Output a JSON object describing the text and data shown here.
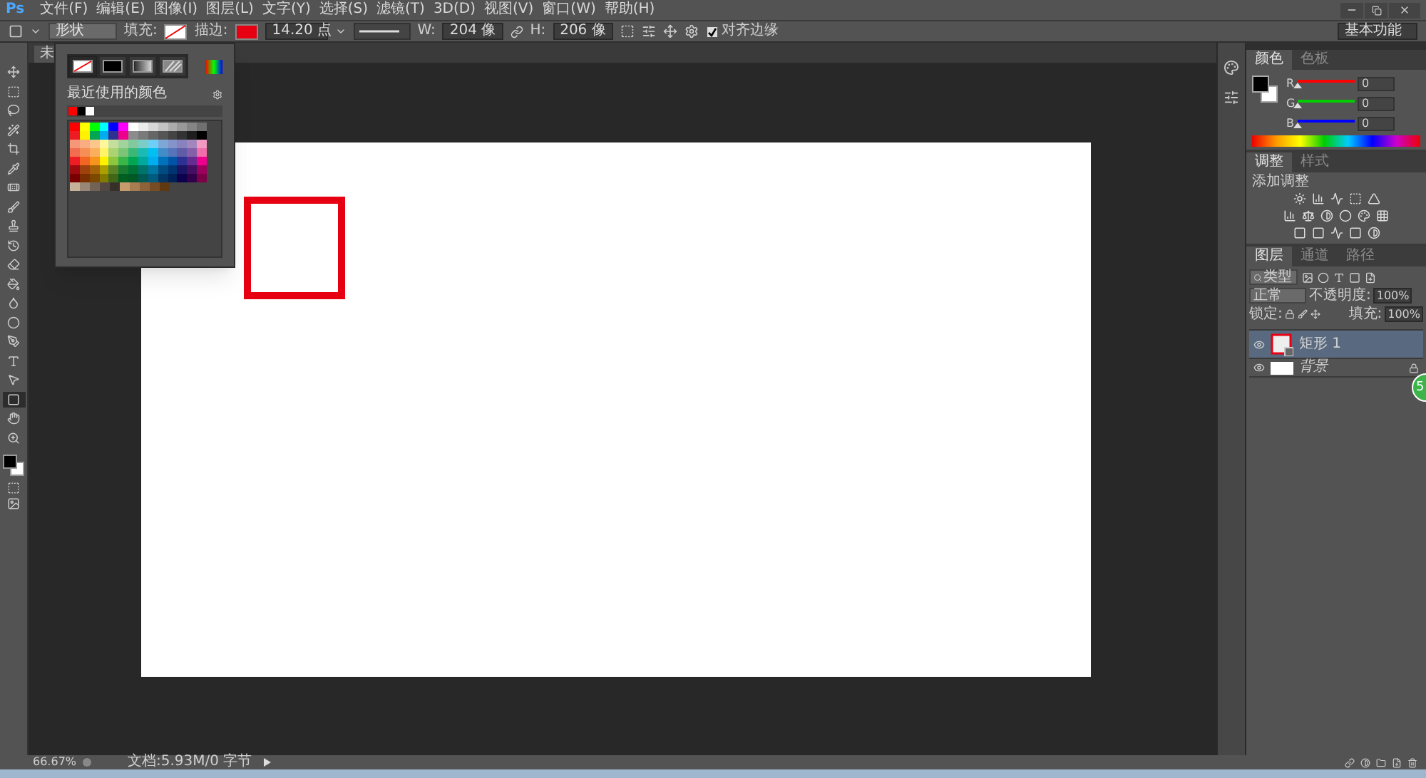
{
  "menu_bar": {
    "logo": "Ps",
    "items": [
      "文件(F)",
      "编辑(E)",
      "图像(I)",
      "图层(L)",
      "文字(Y)",
      "选择(S)",
      "滤镜(T)",
      "3D(D)",
      "视图(V)",
      "窗口(W)",
      "帮助(H)"
    ]
  },
  "options_bar": {
    "shape_mode": "形状",
    "fill_label": "填充:",
    "stroke_label": "描边:",
    "stroke_swatch": {
      "color": "#e60012"
    },
    "stroke_width": "14.20 点",
    "w_label": "W:",
    "w_value": "204 像",
    "h_label": "H:",
    "h_value": "206 像",
    "align_edges": {
      "label": "对齐边缘",
      "checked": true
    },
    "workspace": "基本功能"
  },
  "toolbar": {
    "tools": [
      {
        "kind": "move",
        "selected": false
      },
      {
        "kind": "marquee",
        "selected": false
      },
      {
        "kind": "lasso",
        "selected": false
      },
      {
        "kind": "wand",
        "selected": false
      },
      {
        "kind": "crop",
        "selected": false
      },
      {
        "kind": "pipette",
        "selected": false
      },
      {
        "kind": "bandage",
        "selected": false
      },
      {
        "kind": "brush",
        "selected": false
      },
      {
        "kind": "stamp",
        "selected": false
      },
      {
        "kind": "history",
        "selected": false
      },
      {
        "kind": "eraser",
        "selected": false
      },
      {
        "kind": "bucket",
        "selected": false
      },
      {
        "kind": "droplet",
        "selected": false
      },
      {
        "kind": "dodge",
        "selected": false
      },
      {
        "kind": "pen",
        "selected": false
      },
      {
        "kind": "type",
        "selected": false
      },
      {
        "kind": "pointer",
        "selected": false
      },
      {
        "kind": "rectangle",
        "selected": true
      },
      {
        "kind": "hand",
        "selected": false
      },
      {
        "kind": "zoom",
        "selected": false
      }
    ]
  },
  "document_tab": "未",
  "swatch_popup": {
    "tabs": [
      {
        "kind": "none",
        "selected": true
      },
      {
        "kind": "solid",
        "selected": false
      },
      {
        "kind": "gradient",
        "selected": false
      },
      {
        "kind": "pattern",
        "selected": false
      }
    ],
    "recent_label": "最近使用的颜色",
    "recent_colors": [
      {
        "color": "#ff0000"
      },
      {
        "color": "#000000"
      },
      {
        "color": "#ffffff"
      }
    ],
    "swatch_rows": [
      {
        "swatches": [
          {
            "color": "#ff0000"
          },
          {
            "color": "#ffff00"
          },
          {
            "color": "#00ff00"
          },
          {
            "color": "#00ffff"
          },
          {
            "color": "#0000ff"
          },
          {
            "color": "#ff00ff"
          },
          {
            "color": "#ffffff"
          },
          {
            "color": "#ebebeb"
          },
          {
            "color": "#d6d6d6"
          },
          {
            "color": "#c2c2c2"
          },
          {
            "color": "#adadad"
          },
          {
            "color": "#999999"
          },
          {
            "color": "#858585"
          },
          {
            "color": "#707070"
          }
        ]
      },
      {
        "swatches": [
          {
            "color": "#ed1c24"
          },
          {
            "color": "#fff200"
          },
          {
            "color": "#00a651"
          },
          {
            "color": "#00aeef"
          },
          {
            "color": "#2e3192"
          },
          {
            "color": "#ec008c"
          },
          {
            "color": "#8c8c8c"
          },
          {
            "color": "#7a7a7a"
          },
          {
            "color": "#666666"
          },
          {
            "color": "#555555"
          },
          {
            "color": "#444444"
          },
          {
            "color": "#333333"
          },
          {
            "color": "#1e1e1e"
          },
          {
            "color": "#000000"
          }
        ]
      },
      {
        "swatches": [
          {
            "color": "#f7977a"
          },
          {
            "color": "#f9ad81"
          },
          {
            "color": "#fdc68a"
          },
          {
            "color": "#fff79a"
          },
          {
            "color": "#c4df9b"
          },
          {
            "color": "#a3d39c"
          },
          {
            "color": "#82ca9d"
          },
          {
            "color": "#7bcdc8"
          },
          {
            "color": "#6ecff6"
          },
          {
            "color": "#7ea7d8"
          },
          {
            "color": "#8493ca"
          },
          {
            "color": "#8882be"
          },
          {
            "color": "#a187be"
          },
          {
            "color": "#f49ac2"
          }
        ]
      },
      {
        "swatches": [
          {
            "color": "#f26c4f"
          },
          {
            "color": "#f68e55"
          },
          {
            "color": "#fbaf5c"
          },
          {
            "color": "#fff467"
          },
          {
            "color": "#acd372"
          },
          {
            "color": "#7cc576"
          },
          {
            "color": "#3bb878"
          },
          {
            "color": "#1abbb4"
          },
          {
            "color": "#00bff3"
          },
          {
            "color": "#438cca"
          },
          {
            "color": "#5574b9"
          },
          {
            "color": "#605ca8"
          },
          {
            "color": "#855fa8"
          },
          {
            "color": "#f06eaa"
          }
        ]
      },
      {
        "swatches": [
          {
            "color": "#ed1c25"
          },
          {
            "color": "#f26522"
          },
          {
            "color": "#f7941d"
          },
          {
            "color": "#fff201"
          },
          {
            "color": "#8dc73f"
          },
          {
            "color": "#39b54a"
          },
          {
            "color": "#00a652"
          },
          {
            "color": "#00a99d"
          },
          {
            "color": "#00aef0"
          },
          {
            "color": "#0072bc"
          },
          {
            "color": "#0054a6"
          },
          {
            "color": "#2e3193"
          },
          {
            "color": "#662d91"
          },
          {
            "color": "#ec008d"
          }
        ]
      },
      {
        "swatches": [
          {
            "color": "#9e0b0f"
          },
          {
            "color": "#a0410d"
          },
          {
            "color": "#a36209"
          },
          {
            "color": "#aba000"
          },
          {
            "color": "#598527"
          },
          {
            "color": "#197b30"
          },
          {
            "color": "#007236"
          },
          {
            "color": "#00746b"
          },
          {
            "color": "#0076a3"
          },
          {
            "color": "#004b80"
          },
          {
            "color": "#003471"
          },
          {
            "color": "#1b1464"
          },
          {
            "color": "#440e62"
          },
          {
            "color": "#9e005d"
          }
        ]
      },
      {
        "swatches": [
          {
            "color": "#790000"
          },
          {
            "color": "#7b2e00"
          },
          {
            "color": "#7d4900"
          },
          {
            "color": "#827b00"
          },
          {
            "color": "#406618"
          },
          {
            "color": "#005e20"
          },
          {
            "color": "#005826"
          },
          {
            "color": "#005952"
          },
          {
            "color": "#005b7f"
          },
          {
            "color": "#003663"
          },
          {
            "color": "#002157"
          },
          {
            "color": "#0d004c"
          },
          {
            "color": "#32004b"
          },
          {
            "color": "#7b0046"
          }
        ]
      },
      {
        "swatches": [
          {
            "color": "#c7b299"
          },
          {
            "color": "#998675"
          },
          {
            "color": "#736357"
          },
          {
            "color": "#534741"
          },
          {
            "color": "#37302a"
          },
          {
            "color": "#c69c6d"
          },
          {
            "color": "#a67c52"
          },
          {
            "color": "#8c6239"
          },
          {
            "color": "#754c24"
          },
          {
            "color": "#603913"
          }
        ]
      }
    ]
  },
  "canvas": {
    "shape": {
      "color": "#e60012"
    }
  },
  "color_panel": {
    "tabs": [
      {
        "label": "颜色",
        "selected": true
      },
      {
        "label": "色板",
        "selected": false
      }
    ],
    "foreground": {
      "color": "#000000"
    },
    "background": {
      "color": "#ffffff"
    },
    "channels": [
      {
        "label": "R",
        "color": "#ff0000",
        "value": "0",
        "level": 0
      },
      {
        "label": "G",
        "color": "#00cc00",
        "value": "0",
        "level": 0
      },
      {
        "label": "B",
        "color": "#0000ff",
        "value": "0",
        "level": 0
      }
    ]
  },
  "adjustments_panel": {
    "tabs": [
      {
        "label": "调整",
        "selected": true
      },
      {
        "label": "样式",
        "selected": false
      }
    ],
    "title": "添加调整"
  },
  "layers_panel": {
    "tabs": [
      {
        "label": "图层",
        "selected": true
      },
      {
        "label": "通道",
        "selected": false
      },
      {
        "label": "路径",
        "selected": false
      }
    ],
    "filter": "类型",
    "blend_mode": "正常",
    "opacity_label": "不透明度:",
    "opacity": "100%",
    "lock_label": "锁定:",
    "fill_label": "填充:",
    "fill": "100%",
    "layers": [
      {
        "name": "矩形 1",
        "kind": "shape",
        "selected": true,
        "visible": true,
        "locked": false
      },
      {
        "name": "背景",
        "kind": "background",
        "selected": false,
        "visible": true,
        "locked": true
      }
    ]
  },
  "badge": "5",
  "status_bar": {
    "zoom": "66.67%",
    "doc_info": "文档:5.93M/0 字节"
  }
}
